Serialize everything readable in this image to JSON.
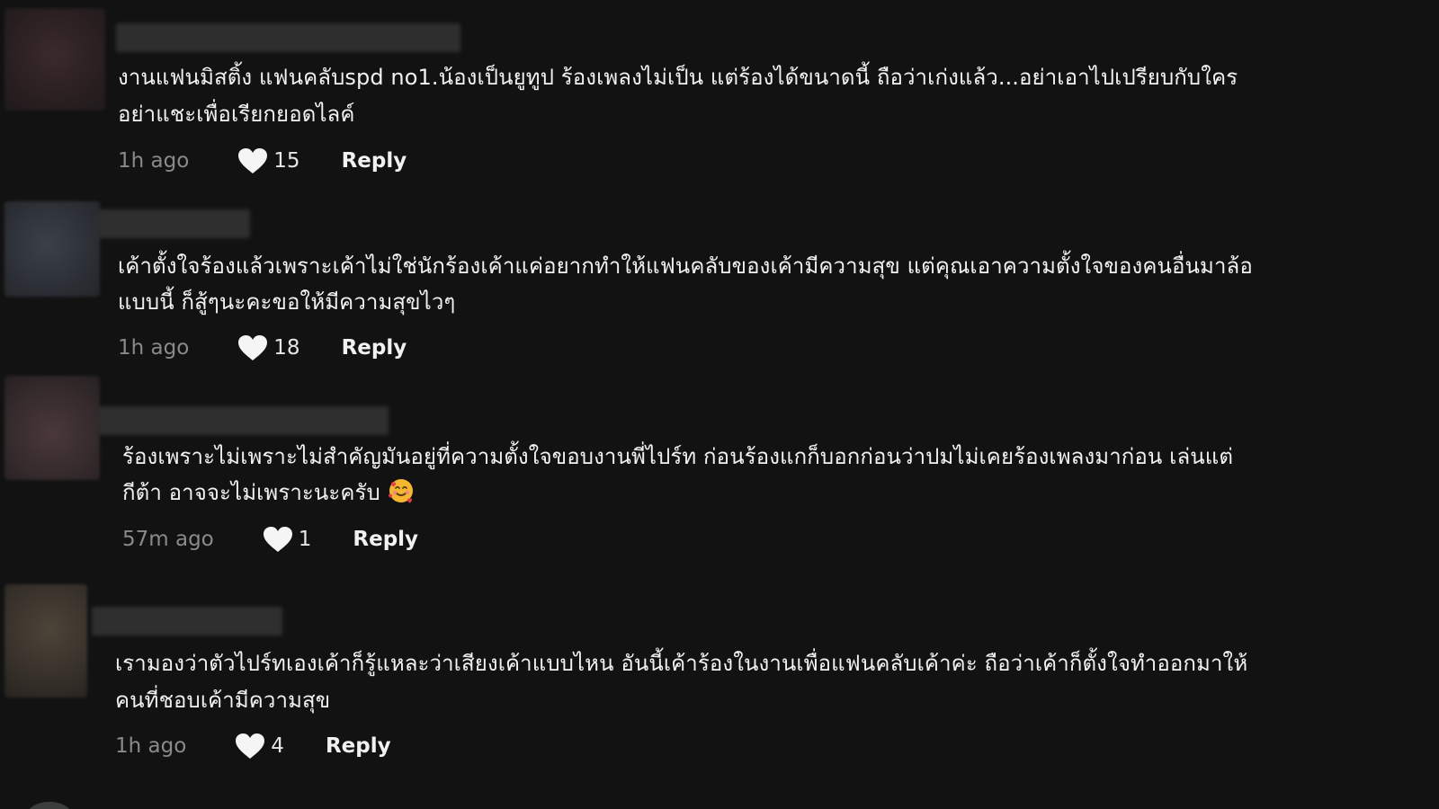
{
  "comments": [
    {
      "line1": "งานแฟนมิสติ้ง แฟนคลับspd no1.น้องเป็นยูทูป ร้องเพลงไม่เป็น แต่ร้องได้ขนาดนี้ ถือว่าเก่งแล้ว...อย่าเอาไปเปรียบกับใคร",
      "line2": "อย่าแชะเพื่อเรียกยอดไลค์",
      "time": "1h ago",
      "likes": "15",
      "reply": "Reply"
    },
    {
      "line1": "เค้าตั้งใจร้องแล้วเพราะเค้าไม่ใช่นักร้องเค้าแค่อยากทำให้แฟนคลับของเค้ามีความสุข แต่คุณเอาความตั้งใจของคนอื่นมาล้อ",
      "line2": "แบบนี้ ก็สู้ๆนะคะขอให้มีความสุขไวๆ",
      "time": "1h ago",
      "likes": "18",
      "reply": "Reply"
    },
    {
      "line1": "ร้องเพราะไม่เพราะไม่สำคัญมันอยู่ที่ความตั้งใจขอบงานพี่ไปร์ท ก่อนร้องแกก็บอกก่อนว่าปมไม่เคยร้องเพลงมาก่อน เล่นแต่",
      "line2": "กีต้า อาจจะไม่เพราะนะครับ",
      "emoji": "smiling-face-with-hearts",
      "time": "57m ago",
      "likes": "1",
      "reply": "Reply"
    },
    {
      "line1": "เรามองว่าตัวไปร์ทเองเค้าก็รู้แหละว่าเสียงเค้าแบบไหน อันนี้เค้าร้องในงานเพื่อแฟนคลับเค้าค่ะ ถือว่าเค้าก็ตั้งใจทำออกมาให้",
      "line2": "คนที่ชอบเค้ามีความสุข",
      "time": "1h ago",
      "likes": "4",
      "reply": "Reply"
    }
  ],
  "icons": {
    "like": "heart-icon",
    "emoji": "smiling-face-with-hearts-icon"
  },
  "colors": {
    "background": "#121212",
    "text": "#f1f1f1",
    "muted": "#8a8a8a"
  }
}
